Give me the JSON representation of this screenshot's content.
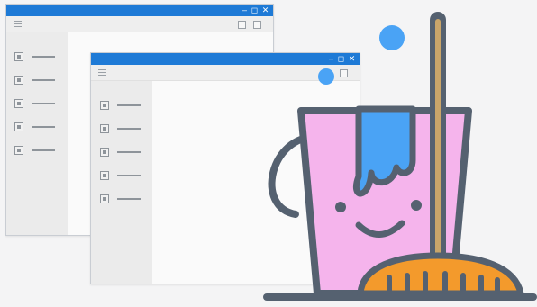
{
  "windows": [
    {
      "id": "back-window",
      "controls": {
        "minimize": "–",
        "maximize": "◻",
        "close": "✕"
      },
      "sidebar_items": 5
    },
    {
      "id": "front-window",
      "controls": {
        "minimize": "–",
        "maximize": "◻",
        "close": "✕"
      },
      "sidebar_items": 5
    }
  ],
  "illustration": {
    "bucket_color": "#f5b4ec",
    "water_color": "#4aa3f5",
    "outline_color": "#556170",
    "broom_color": "#f39a2c",
    "handle_color": "#c9a56a",
    "titlebar_color": "#1e7ad6",
    "icons": [
      "cleaning-bucket-icon",
      "broom-icon",
      "water-drop-icon"
    ]
  }
}
